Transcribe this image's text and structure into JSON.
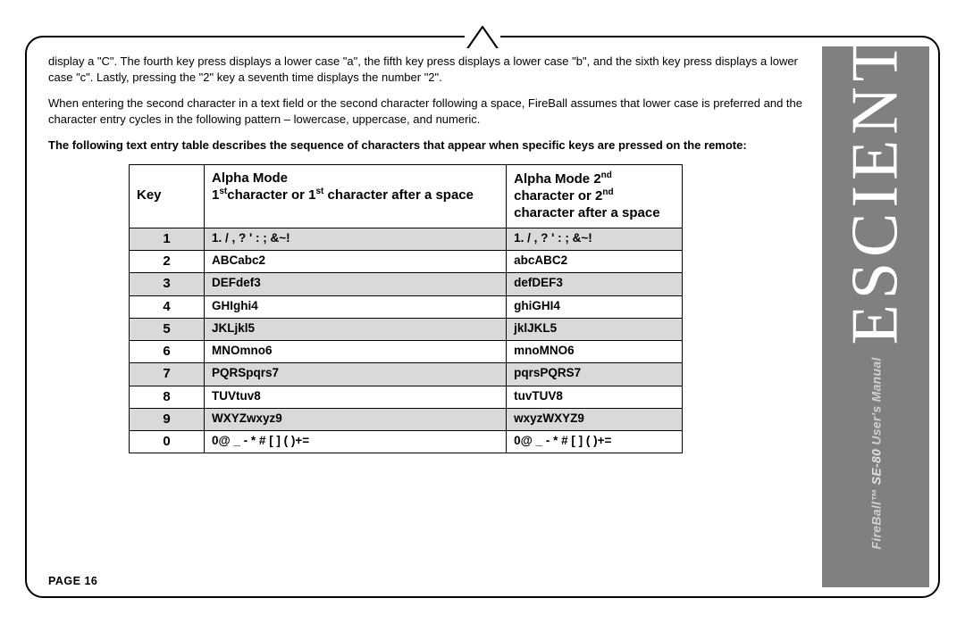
{
  "sidebar": {
    "manual_prefix": "FireBall™",
    "manual_model": "SE-80",
    "manual_suffix": "User's Manual",
    "brand": "ESCIENT",
    "reg": "®"
  },
  "body": {
    "p1": "display a \"C\".  The fourth key press displays a lower case \"a\", the fifth key press displays a lower case \"b\", and the sixth key press displays a lower case \"c\".  Lastly, pressing the \"2\" key a seventh time displays the number \"2\".",
    "p2": "When entering the second character in a text field or the second character following a space, FireBall assumes that lower case is preferred and the character entry cycles in the following pattern – lowercase, uppercase, and numeric.",
    "p3": "The following text entry table describes the sequence of characters that appear when specific keys are pressed on the remote:"
  },
  "table": {
    "head": {
      "key": "Key",
      "col1_a": "Alpha Mode",
      "col1_b_pre": "1",
      "col1_b_sup1": "st",
      "col1_b_mid": "character or 1",
      "col1_b_sup2": "st",
      "col1_b_post": " character after a space",
      "col2_a_pre": "Alpha Mode 2",
      "col2_a_sup": "nd",
      "col2_b_pre": "character or 2",
      "col2_b_sup": "nd",
      "col2_c": "character after a space"
    },
    "rows": [
      {
        "key": "1",
        "c1": "1. / , ? ' : ; &~!",
        "c2": "1. / , ? ' : ; &~!"
      },
      {
        "key": "2",
        "c1": "ABCabc2",
        "c2": "abcABC2"
      },
      {
        "key": "3",
        "c1": "DEFdef3",
        "c2": "defDEF3"
      },
      {
        "key": "4",
        "c1": "GHIghi4",
        "c2": "ghiGHI4"
      },
      {
        "key": "5",
        "c1": "JKLjkl5",
        "c2": "jklJKL5"
      },
      {
        "key": "6",
        "c1": "MNOmno6",
        "c2": "mnoMNO6"
      },
      {
        "key": "7",
        "c1": "PQRSpqrs7",
        "c2": "pqrsPQRS7"
      },
      {
        "key": "8",
        "c1": "TUVtuv8",
        "c2": "tuvTUV8"
      },
      {
        "key": "9",
        "c1": "WXYZwxyz9",
        "c2": "wxyzWXYZ9"
      },
      {
        "key": "0",
        "c1": "0@ _ - * # [ ] ( )+=",
        "c2": "0@ _ - * # [ ] ( )+="
      }
    ]
  },
  "footer": {
    "page_label": "PAGE 16"
  }
}
